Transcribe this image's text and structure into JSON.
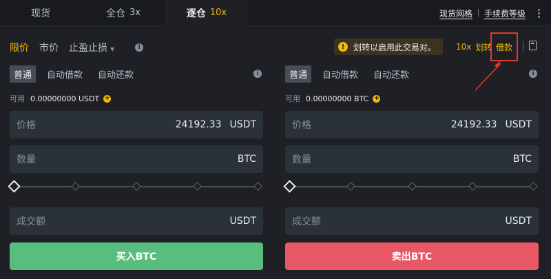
{
  "tabs": {
    "spot": "现货",
    "cross": {
      "label": "全仓",
      "leverage": "3x"
    },
    "isolated": {
      "label": "逐仓",
      "leverage": "10x"
    }
  },
  "top_links": {
    "spot_grid": "现货网格",
    "fee_level": "手续费等级"
  },
  "order_types": {
    "limit": "限价",
    "market": "市价",
    "stop": "止盈止损"
  },
  "toast": {
    "text": "划转以启用此交易对。"
  },
  "margin_actions": {
    "leverage": "10x",
    "transfer": "划转",
    "borrow": "借款"
  },
  "buy_panel": {
    "modes": [
      "普通",
      "自动借款",
      "自动还款"
    ],
    "available_label": "可用",
    "available_value": "0.00000000 USDT",
    "price_label": "价格",
    "price_value": "24192.33",
    "price_unit": "USDT",
    "amount_label": "数量",
    "amount_unit": "BTC",
    "total_label": "成交额",
    "total_unit": "USDT",
    "button": "买入BTC"
  },
  "sell_panel": {
    "modes": [
      "普通",
      "自动借款",
      "自动还款"
    ],
    "available_label": "可用",
    "available_value": "0.00000000 BTC",
    "price_label": "价格",
    "price_value": "24192.33",
    "price_unit": "USDT",
    "amount_label": "数量",
    "amount_unit": "BTC",
    "total_label": "成交额",
    "total_unit": "USDT",
    "button": "卖出BTC"
  },
  "colors": {
    "accent": "#f0b90b",
    "buy": "#58bd7d",
    "sell": "#e85864",
    "highlight": "#e03a2c"
  }
}
